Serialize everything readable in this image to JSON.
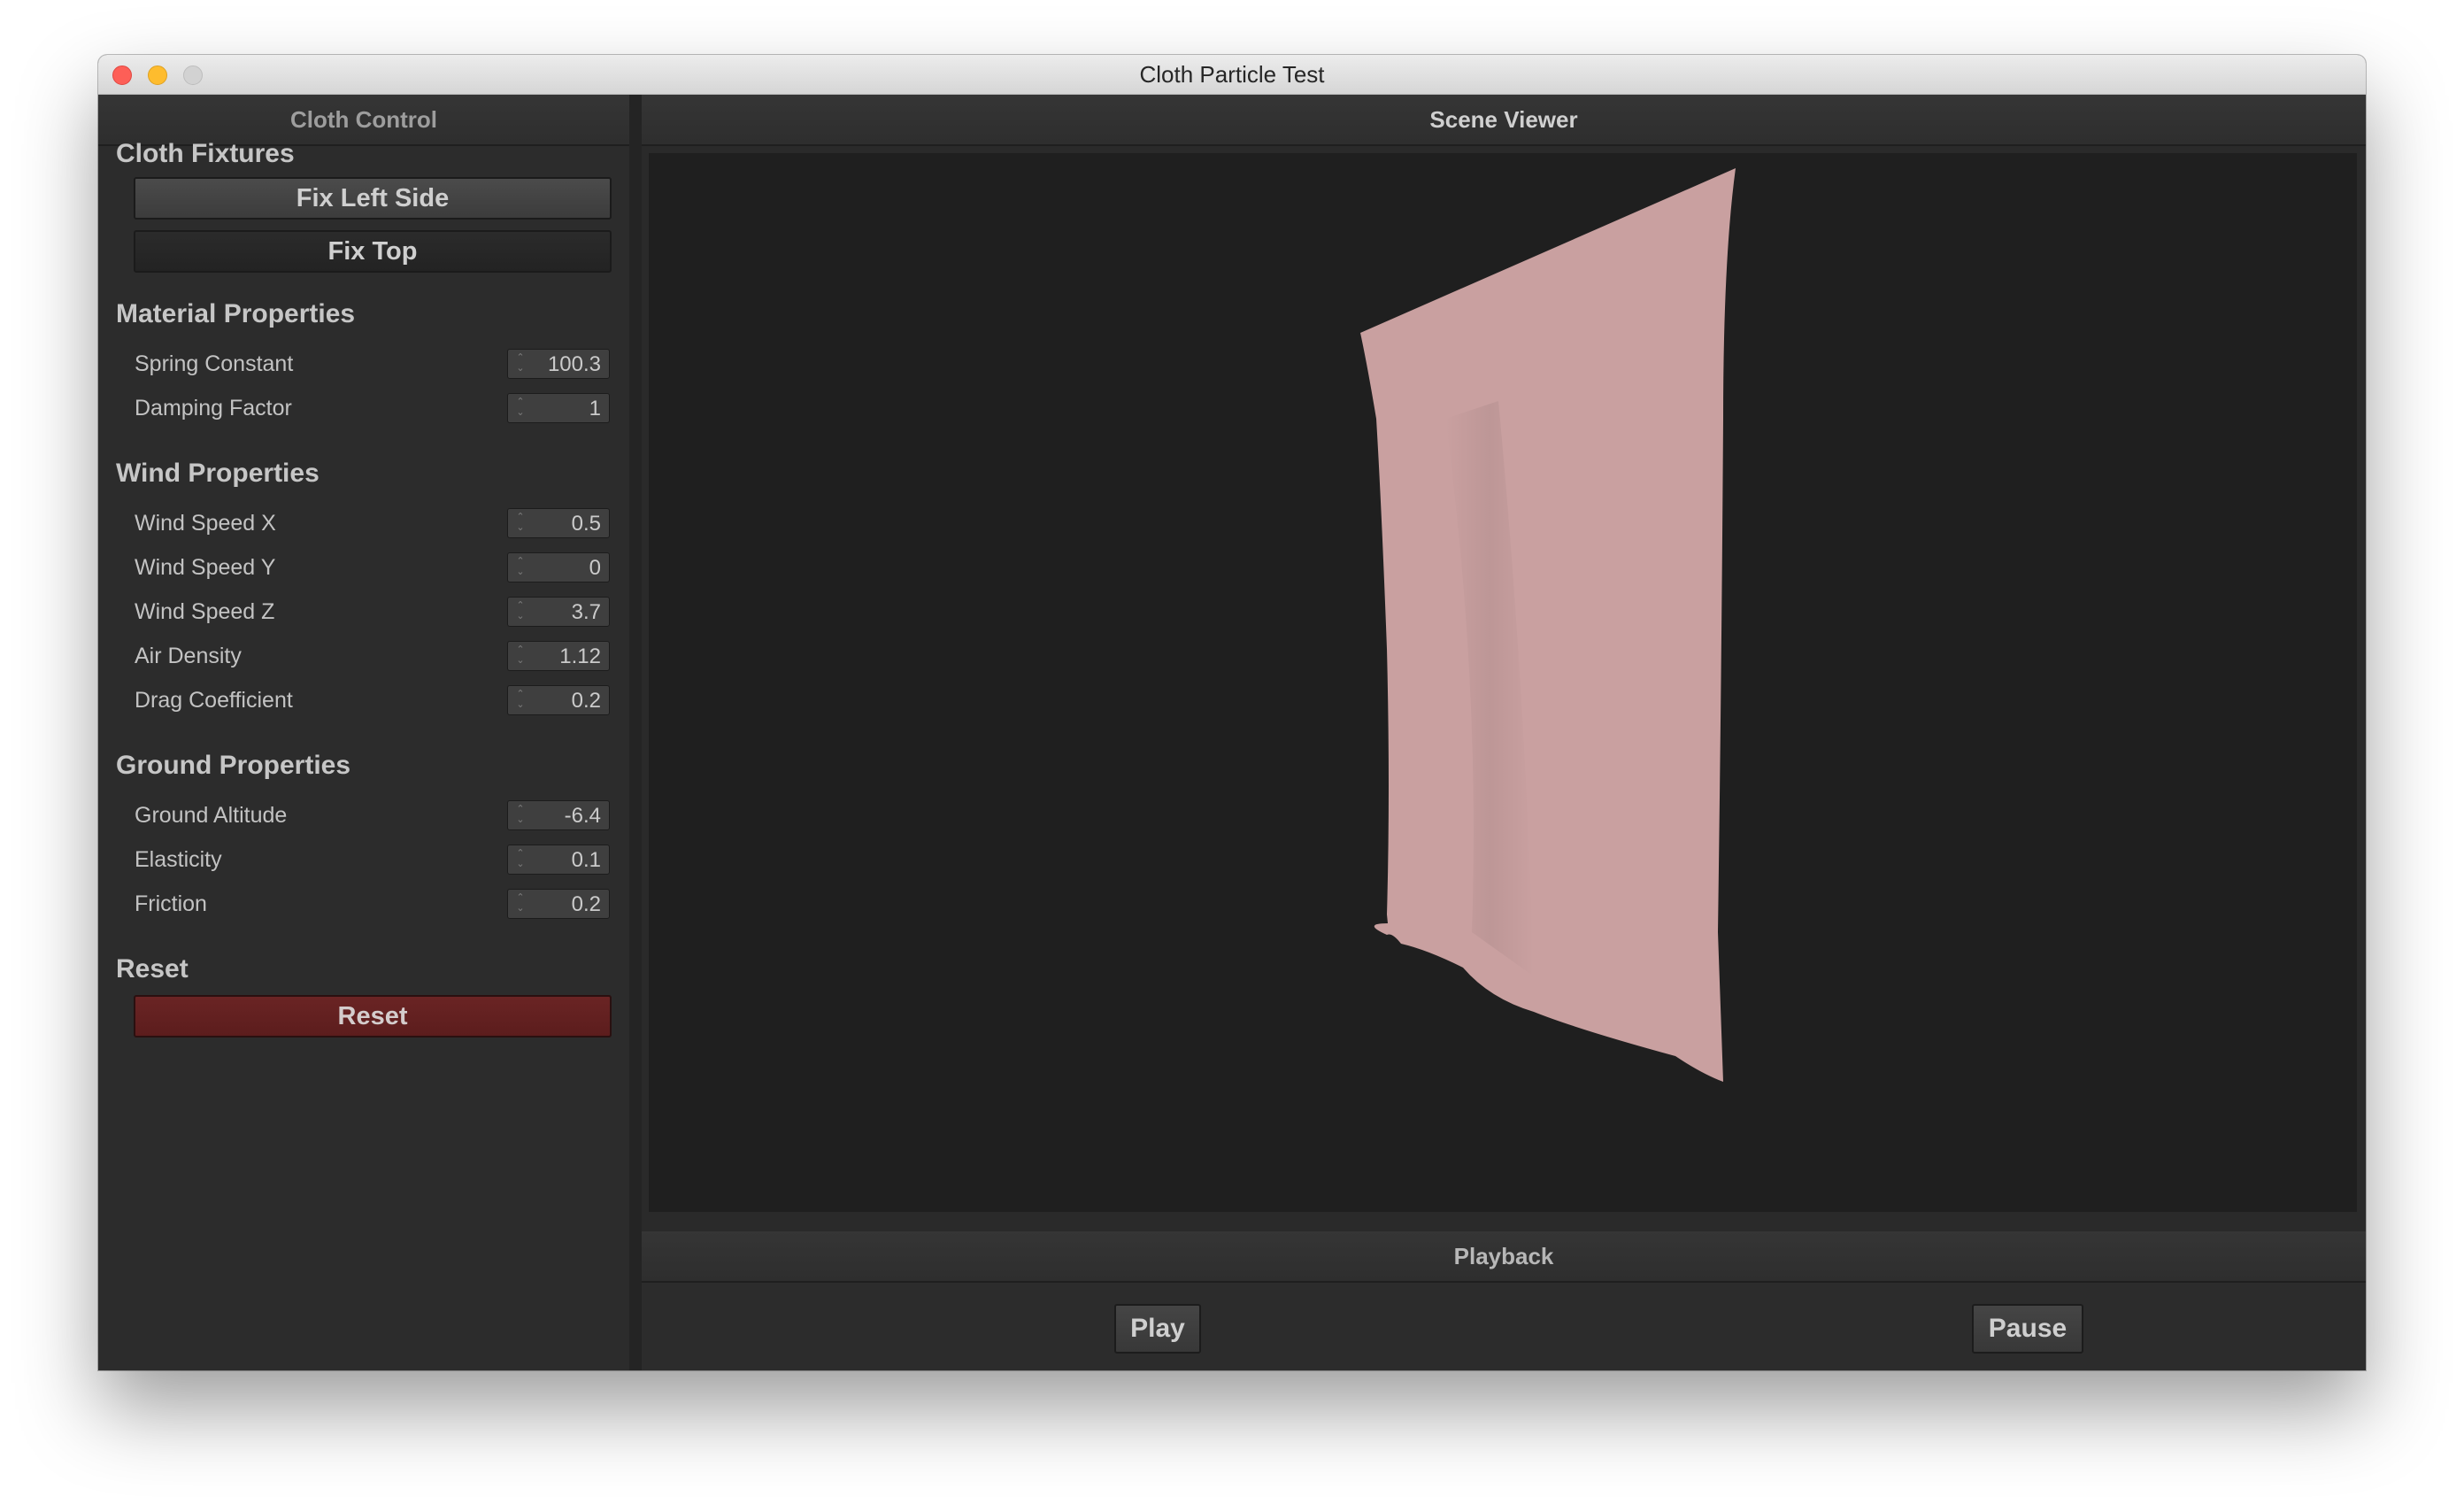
{
  "window": {
    "title": "Cloth Particle Test"
  },
  "left_panel": {
    "header": "Cloth Control",
    "sections": {
      "fixtures": {
        "title": "Cloth Fixtures",
        "fix_left_label": "Fix Left Side",
        "fix_top_label": "Fix Top"
      },
      "material": {
        "title": "Material Properties",
        "props": [
          {
            "label": "Spring Constant",
            "value": "100.3"
          },
          {
            "label": "Damping Factor",
            "value": "1"
          }
        ]
      },
      "wind": {
        "title": "Wind Properties",
        "props": [
          {
            "label": "Wind Speed X",
            "value": "0.5"
          },
          {
            "label": "Wind Speed Y",
            "value": "0"
          },
          {
            "label": "Wind Speed Z",
            "value": "3.7"
          },
          {
            "label": "Air Density",
            "value": "1.12"
          },
          {
            "label": "Drag Coefficient",
            "value": "0.2"
          }
        ]
      },
      "ground": {
        "title": "Ground Properties",
        "props": [
          {
            "label": "Ground Altitude",
            "value": "-6.4"
          },
          {
            "label": "Elasticity",
            "value": "0.1"
          },
          {
            "label": "Friction",
            "value": "0.2"
          }
        ]
      },
      "reset": {
        "title": "Reset",
        "button_label": "Reset"
      }
    }
  },
  "scene": {
    "header": "Scene Viewer",
    "cloth_color": "#c9a0a0"
  },
  "playback": {
    "header": "Playback",
    "play_label": "Play",
    "pause_label": "Pause"
  },
  "colors": {
    "reset_button": "#5f1f1f",
    "viewport_bg": "#1f1f1f",
    "panel_bg": "#2c2c2c"
  }
}
